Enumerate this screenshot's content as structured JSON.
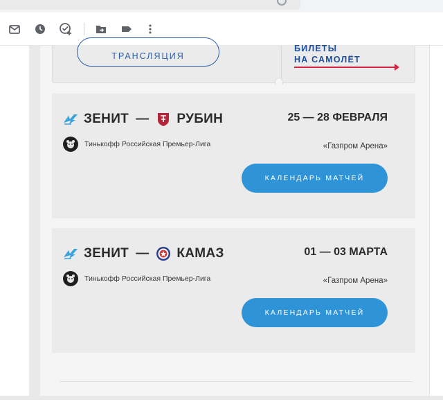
{
  "toolbar": {
    "icons": [
      "mark-unread-icon",
      "snooze-icon",
      "add-task-icon",
      "move-to-icon",
      "label-icon",
      "more-vert-icon"
    ]
  },
  "promo": {
    "broadcast_label": "ТРАНСЛЯЦИЯ",
    "tickets_line1": "БИЛЕТЫ",
    "tickets_line2": "НА САМОЛЁТ",
    "accent_color": "#d0243f"
  },
  "matches": [
    {
      "home": "ЗЕНИТ",
      "separator": "—",
      "away": "РУБИН",
      "date": "25 — 28 ФЕВРАЛЯ",
      "league": "Тинькофф Российская Премьер-Лига",
      "venue": "«Газпром Арена»",
      "button": "КАЛЕНДАРЬ МАТЧЕЙ"
    },
    {
      "home": "ЗЕНИТ",
      "separator": "—",
      "away": "КАМАЗ",
      "date": "01 — 03 МАРТА",
      "league": "Тинькофф Российская Премьер-Лига",
      "venue": "«Газпром Арена»",
      "button": "КАЛЕНДАРЬ МАТЧЕЙ"
    }
  ],
  "colors": {
    "button_blue": "#2f93d8",
    "link_blue": "#1d4f9c",
    "zenit_blue": "#3aa3dc",
    "rubin_red": "#b5253a",
    "kamaz_blue": "#2c3f8f"
  }
}
